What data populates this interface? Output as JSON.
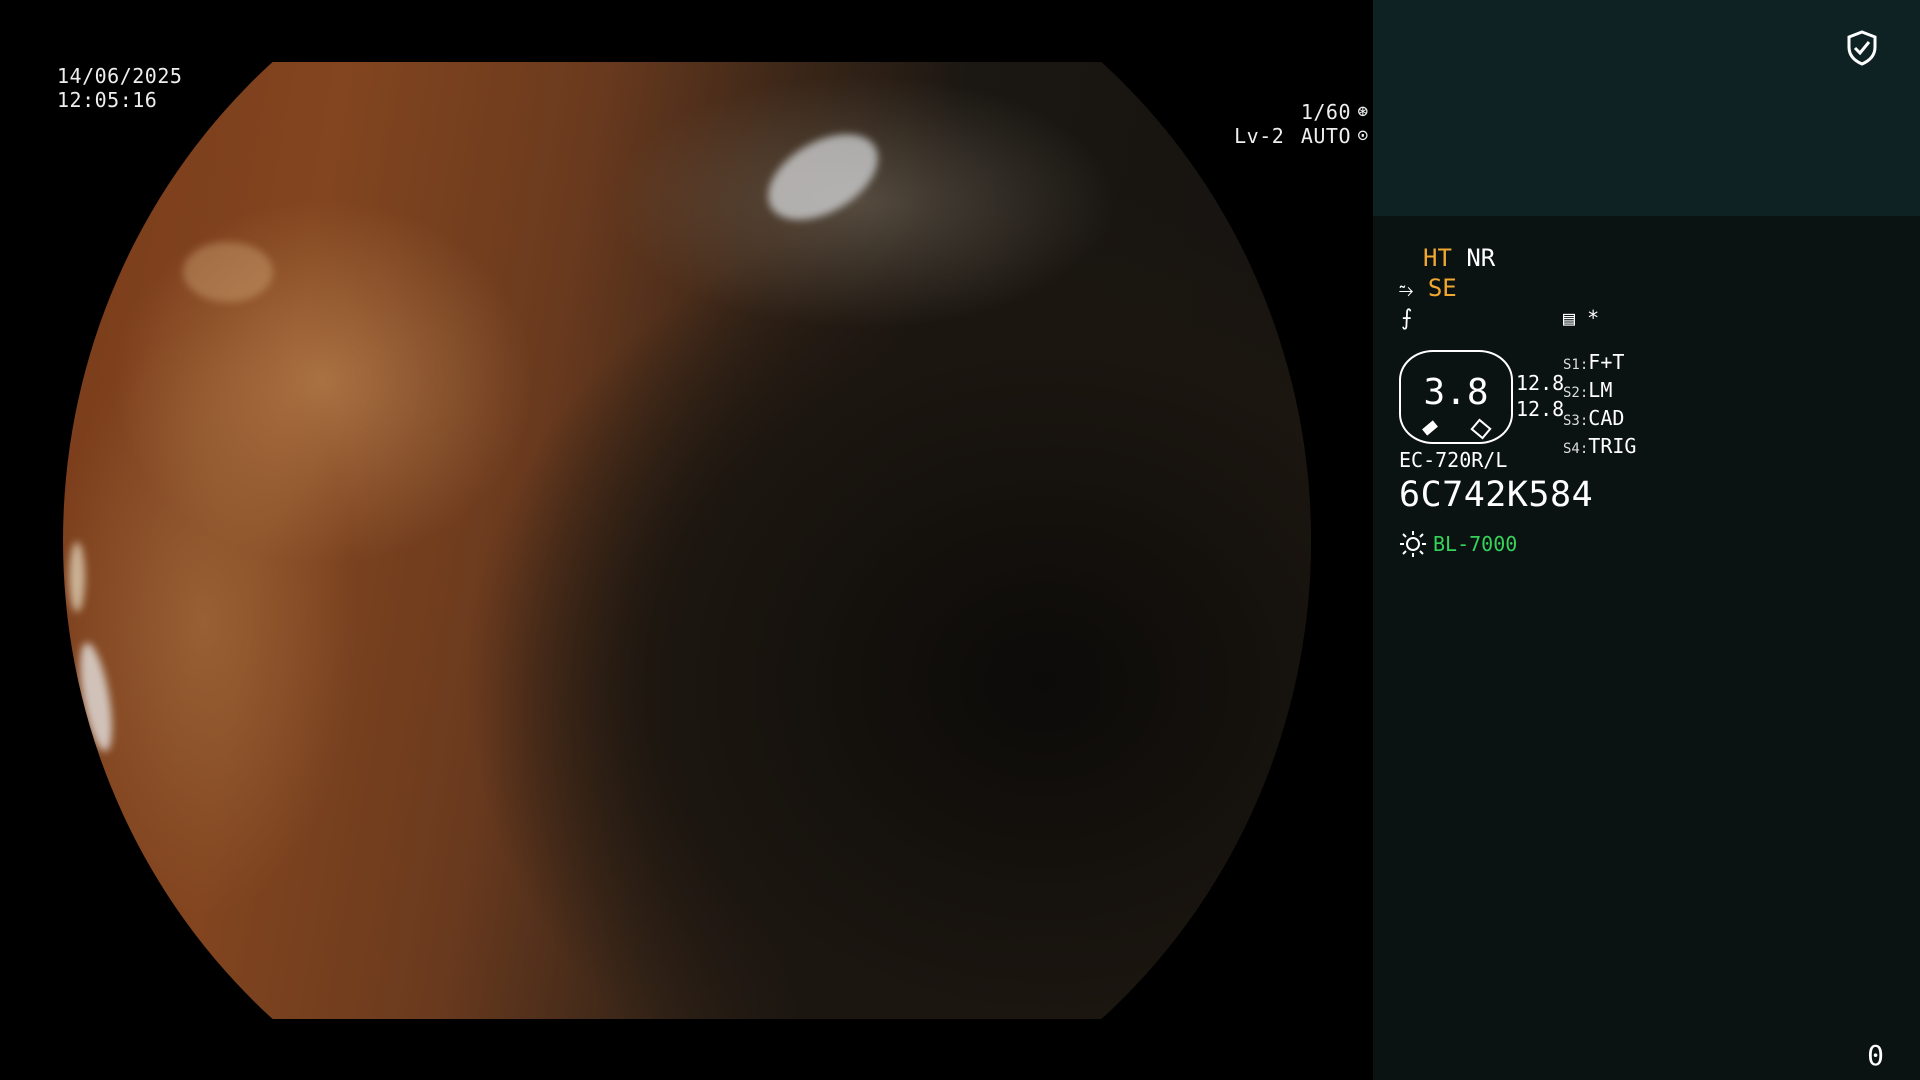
{
  "video": {
    "date": "14/06/2025",
    "time": "12:05:16",
    "shutter": "1/60",
    "shutter_icon": "aperture-icon",
    "level": "Lv-2",
    "mode": "AUTO",
    "mode_icon": "iris-icon"
  },
  "panel": {
    "header_icon": "shield-check-icon",
    "indicators": {
      "ht": "HT",
      "nr": "NR",
      "se": "SE",
      "star": "*"
    },
    "scope": {
      "value": "3.8",
      "stat_top": "12.8",
      "stat_bottom": "12.8",
      "model": "EC-720R/L",
      "serial": "6C742K584"
    },
    "slots": [
      {
        "key": "S1:",
        "value": "F+T"
      },
      {
        "key": "S2:",
        "value": "LM"
      },
      {
        "key": "S3:",
        "value": "CAD"
      },
      {
        "key": "S4:",
        "value": "TRIG"
      }
    ],
    "light_source": "BL-7000",
    "counter": "0"
  },
  "colors": {
    "panel_bg": "#0b1212",
    "panel_header": "#0e2224",
    "accent_orange": "#f0a830",
    "accent_green": "#35d35a"
  }
}
